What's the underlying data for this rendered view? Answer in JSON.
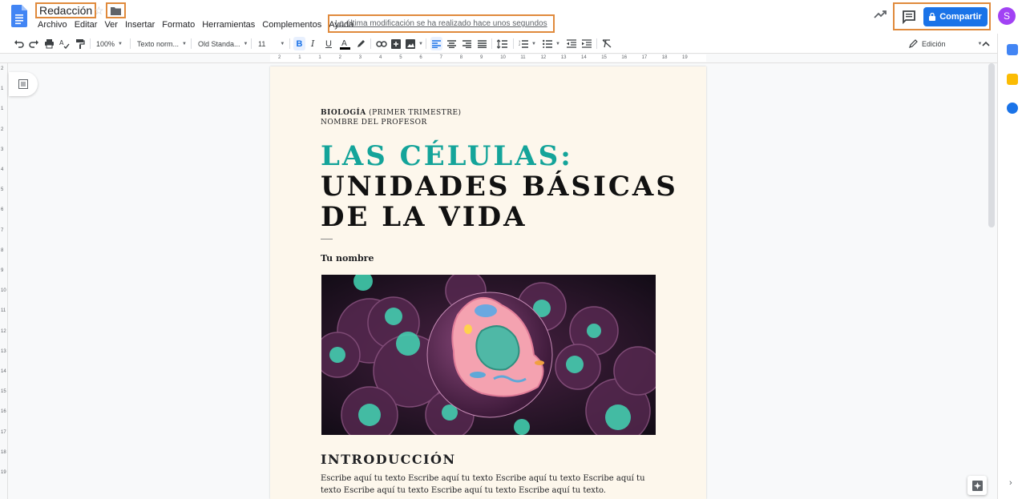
{
  "document": {
    "title": "Redacción",
    "last_modified": "La última modificación se ha realizado hace unos segundos"
  },
  "menu": [
    "Archivo",
    "Editar",
    "Ver",
    "Insertar",
    "Formato",
    "Herramientas",
    "Complementos",
    "Ayuda"
  ],
  "share": {
    "label": "Compartir"
  },
  "user": {
    "avatar_letter": "S"
  },
  "toolbar": {
    "zoom": "100%",
    "style": "Texto norm...",
    "font": "Old Standa...",
    "size": "11",
    "bold": "B",
    "italic": "I",
    "underline": "U",
    "mode": "Edición"
  },
  "ruler": [
    "2",
    "1",
    "1",
    "2",
    "3",
    "4",
    "5",
    "6",
    "7",
    "8",
    "9",
    "10",
    "11",
    "12",
    "13",
    "14",
    "15",
    "16",
    "17",
    "18",
    "19"
  ],
  "vruler": [
    "2",
    "1",
    "1",
    "2",
    "3",
    "4",
    "5",
    "6",
    "7",
    "8",
    "9",
    "10",
    "11",
    "12",
    "13",
    "14",
    "15",
    "16",
    "17",
    "18",
    "19"
  ],
  "page": {
    "subject_bold": "BIOLOGÍA",
    "subject_rest": " (PRIMER TRIMESTRE)",
    "teacher": "NOMBRE DEL PROFESOR",
    "title_line1": "LAS CÉLULAS:",
    "title_line2": "UNIDADES BÁSICAS",
    "title_line3": "DE LA VIDA",
    "author": "Tu nombre",
    "section_heading": "INTRODUCCIÓN",
    "body_text": "Escribe aquí tu texto Escribe aquí tu texto Escribe aquí tu texto Escribe aquí tu texto Escribe aquí tu texto Escribe aquí tu texto Escribe aquí tu texto."
  },
  "colors": {
    "accent": "#1a73e8",
    "highlight_box": "#e08a3c",
    "title_teal": "#14a49a",
    "page_bg": "#fdf7ec"
  },
  "icons": [
    "docs-icon",
    "star-icon",
    "folder-icon",
    "trend-icon",
    "comment-icon",
    "lock-icon",
    "undo-icon",
    "redo-icon",
    "print-icon",
    "spellcheck-icon",
    "paint-format-icon",
    "text-color-icon",
    "highlight-icon",
    "link-icon",
    "comment-add-icon",
    "image-icon",
    "align-left-icon",
    "align-center-icon",
    "align-right-icon",
    "justify-icon",
    "line-spacing-icon",
    "numbered-list-icon",
    "bulleted-list-icon",
    "indent-decrease-icon",
    "indent-increase-icon",
    "clear-format-icon",
    "pencil-icon",
    "outline-icon",
    "calendar-icon",
    "keep-icon",
    "tasks-icon",
    "explore-icon"
  ]
}
